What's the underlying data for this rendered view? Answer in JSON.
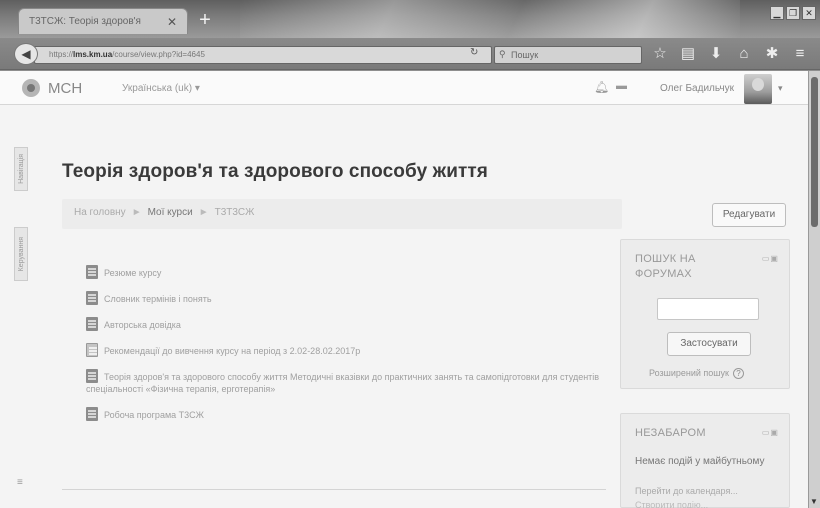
{
  "browser": {
    "tab_title": "Т3ТСЖ: Теорія здоров'я",
    "tab_close": "✕",
    "new_tab": "+",
    "url_prefix": "https://",
    "url_host": "lms.km.ua",
    "url_path": "/course/view.php?id=4645",
    "search_placeholder": "Пошук",
    "window_controls": [
      "▁",
      "❐",
      "✕"
    ]
  },
  "header": {
    "site_name": "МСН",
    "language": "Українська (uk) ▾",
    "user_name": "Олег Бадильчук",
    "user_caret": "▾"
  },
  "drawer": {
    "tab1": "Навігація",
    "tab2": "Керування"
  },
  "page": {
    "title": "Теорія здоров'я та здорового способу життя",
    "breadcrumb": [
      "На головну",
      "Мої курси",
      "Т3Т3СЖ"
    ],
    "edit_label": "Редагувати"
  },
  "course_items": [
    {
      "label": "Резюме курсу",
      "icon": "file-icon"
    },
    {
      "label": "Словник термінів і понять",
      "icon": "file-icon"
    },
    {
      "label": "Авторська довідка",
      "icon": "file-icon"
    },
    {
      "label": "Рекомендації до вивчення курсу на період з 2.02-28.02.2017р",
      "icon": "page-icon"
    },
    {
      "label": "Теорія здоров'я та здорового способу життя Методичні вказівки до практичних занять та самопідготовки для студентів спеціальності «Фізична терапія, ерготерапія»",
      "icon": "file-icon"
    },
    {
      "label": "Робоча програма Т3СЖ",
      "icon": "file-icon"
    }
  ],
  "forum_search": {
    "title": "ПОШУК НА ФОРУМАХ",
    "apply_label": "Застосувати",
    "advanced_label": "Розширений пошук",
    "help": "?"
  },
  "upcoming": {
    "title": "НЕЗАБАРОМ",
    "no_events": "Немає подій у майбутньому",
    "calendar_link": "Перейти до календаря...",
    "new_event": "Створити подію..."
  },
  "colors": {
    "page_bg": "#f4f4f4",
    "block_bg": "#ececec",
    "chrome": "#7a7a7a"
  }
}
